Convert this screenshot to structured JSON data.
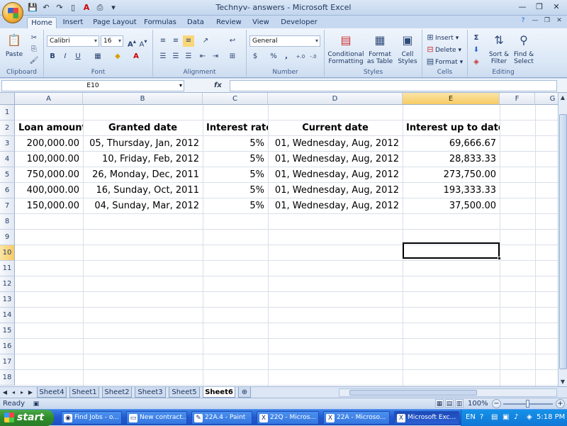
{
  "window": {
    "title": "Technyv- answers - Microsoft Excel",
    "qat_icons": [
      "save-icon",
      "undo-icon",
      "redo-icon",
      "new-doc-icon",
      "font-color-icon",
      "print-preview-icon",
      "customize-icon"
    ]
  },
  "ribbon": {
    "tabs": [
      "Home",
      "Insert",
      "Page Layout",
      "Formulas",
      "Data",
      "Review",
      "View",
      "Developer"
    ],
    "active_tab": "Home",
    "clipboard": {
      "paste": "Paste",
      "label": "Clipboard"
    },
    "font": {
      "name": "Calibri",
      "size": "16",
      "label": "Font",
      "bold": "B",
      "italic": "I",
      "underline": "U"
    },
    "alignment": {
      "label": "Alignment"
    },
    "number": {
      "format": "General",
      "label": "Number",
      "currency": "$",
      "percent": "%",
      "comma": ",",
      "inc_dec": ".0 .00",
      "dec_dec": ".00 .0"
    },
    "styles": {
      "conditional": "Conditional Formatting",
      "conditional_l1": "Conditional",
      "conditional_l2": "Formatting",
      "table_l1": "Format",
      "table_l2": "as Table",
      "cell_l1": "Cell",
      "cell_l2": "Styles",
      "label": "Styles"
    },
    "cells": {
      "insert": "Insert",
      "delete": "Delete",
      "format": "Format",
      "label": "Cells"
    },
    "editing": {
      "sort_l1": "Sort &",
      "sort_l2": "Filter",
      "find_l1": "Find &",
      "find_l2": "Select",
      "label": "Editing",
      "sigma": "Σ"
    }
  },
  "formula_bar": {
    "name_box": "E10",
    "fx": "fx",
    "value": ""
  },
  "sheet": {
    "columns": [
      "A",
      "B",
      "C",
      "D",
      "E",
      "F",
      "G"
    ],
    "rows": [
      "1",
      "2",
      "3",
      "4",
      "5",
      "6",
      "7",
      "8",
      "9",
      "10",
      "11",
      "12",
      "13",
      "14",
      "15",
      "16",
      "17",
      "18"
    ],
    "headers": {
      "loan_amount": "Loan amount",
      "granted_date": "Granted date",
      "interest_rate": "Interest rate",
      "current_date": "Current date",
      "interest_to_date": "Interest up to date"
    },
    "data": [
      {
        "loan": "200,000.00",
        "granted": "05, Thursday, Jan, 2012",
        "rate": "5%",
        "current": "01, Wednesday, Aug, 2012",
        "interest": "69,666.67"
      },
      {
        "loan": "100,000.00",
        "granted": "10, Friday, Feb, 2012",
        "rate": "5%",
        "current": "01, Wednesday, Aug, 2012",
        "interest": "28,833.33"
      },
      {
        "loan": "750,000.00",
        "granted": "26, Monday, Dec, 2011",
        "rate": "5%",
        "current": "01, Wednesday, Aug, 2012",
        "interest": "273,750.00"
      },
      {
        "loan": "400,000.00",
        "granted": "16, Sunday, Oct, 2011",
        "rate": "5%",
        "current": "01, Wednesday, Aug, 2012",
        "interest": "193,333.33"
      },
      {
        "loan": "150,000.00",
        "granted": "04, Sunday, Mar, 2012",
        "rate": "5%",
        "current": "01, Wednesday, Aug, 2012",
        "interest": "37,500.00"
      }
    ],
    "selected_cell": "E10"
  },
  "sheet_tabs": [
    "Sheet4",
    "Sheet1",
    "Sheet2",
    "Sheet3",
    "Sheet5",
    "Sheet6"
  ],
  "active_sheet": "Sheet6",
  "status": {
    "text": "Ready",
    "zoom": "100%"
  },
  "taskbar": {
    "start": "start",
    "items": [
      {
        "label": "Find Jobs - o...",
        "icon": "chrome-icon"
      },
      {
        "label": "New contract...",
        "icon": "folder-icon"
      },
      {
        "label": "22A.4 - Paint",
        "icon": "paint-icon"
      },
      {
        "label": "22Q - Micros...",
        "icon": "excel-icon"
      },
      {
        "label": "22A - Microso...",
        "icon": "excel-icon"
      },
      {
        "label": "Microsoft Exc...",
        "icon": "excel-icon"
      }
    ],
    "active_item": 5,
    "tray": {
      "lang": "EN",
      "time": "5:18 PM"
    }
  }
}
